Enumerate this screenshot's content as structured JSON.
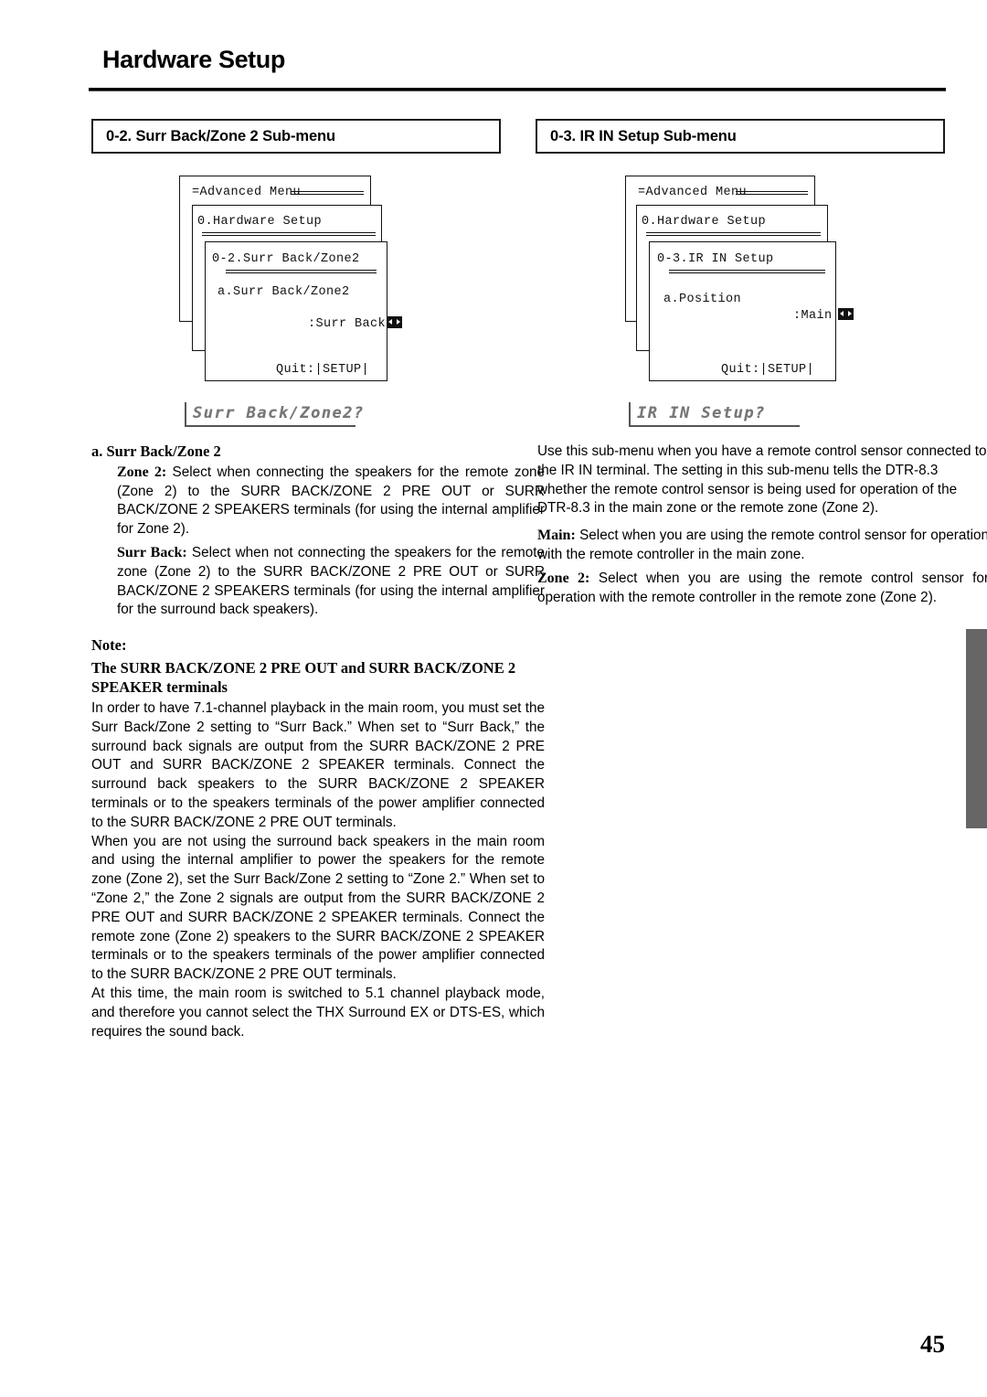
{
  "page": {
    "title": "Hardware Setup",
    "folio": "45"
  },
  "sections": {
    "left": {
      "heading": "0-2. Surr Back/Zone 2 Sub-menu"
    },
    "right": {
      "heading": "0-3. IR IN Setup Sub-menu"
    }
  },
  "osd_left": {
    "pane1_line": "=Advanced Menu",
    "pane2_line": "0.Hardware Setup",
    "pane3_title": "0-2.Surr Back/Zone2",
    "pane3_item": "a.Surr Back/Zone2",
    "pane3_value": ":Surr Back",
    "pane3_quit": "Quit:|SETUP|",
    "lcd": "Surr Back/Zone2?"
  },
  "osd_right": {
    "pane1_line": "=Advanced Menu",
    "pane2_line": "0.Hardware Setup",
    "pane3_title": "0-3.IR IN Setup",
    "pane3_item": "a.Position",
    "pane3_value": ":Main",
    "pane3_quit": "Quit:|SETUP|",
    "lcd": "IR IN Setup?"
  },
  "left_column": {
    "subhead": "a. Surr Back/Zone 2",
    "zone2_label": "Zone 2:",
    "zone2_text": " Select when connecting the speakers for the remote zone (Zone 2) to the SURR BACK/ZONE 2 PRE OUT or SURR BACK/ZONE 2 SPEAKERS terminals (for using the internal amplifier for Zone 2).",
    "surrback_label": "Surr Back:",
    "surrback_text": " Select when not connecting the speakers for the remote zone (Zone 2) to the SURR BACK/ZONE 2 PRE OUT or SURR BACK/ZONE 2 SPEAKERS terminals (for using the internal amplifier for the surround back speakers).",
    "note_heading": "Note:",
    "note_subheading": "The SURR BACK/ZONE 2 PRE OUT and SURR BACK/ZONE 2 SPEAKER terminals",
    "note_p1": "In order to have 7.1-channel playback in the main room, you must set the Surr Back/Zone 2 setting to “Surr Back.” When set to “Surr Back,” the surround back signals are output from the SURR BACK/ZONE 2 PRE OUT and SURR BACK/ZONE 2 SPEAKER terminals. Connect the surround back speakers to the SURR BACK/ZONE 2 SPEAKER terminals or to the speakers terminals of the power amplifier connected to the SURR BACK/ZONE 2 PRE OUT terminals.",
    "note_p2": "When you are not using the surround back speakers in the main room and using the internal amplifier to power the speakers for the remote zone (Zone 2), set the Surr Back/Zone 2 setting to “Zone 2.” When set to “Zone 2,” the Zone 2 signals are output from the SURR BACK/ZONE 2 PRE OUT and SURR BACK/ZONE 2 SPEAKER terminals. Connect the remote zone (Zone 2) speakers to the SURR BACK/ZONE 2 SPEAKER terminals or to the speakers terminals of the power amplifier connected to the SURR BACK/ZONE 2 PRE OUT terminals.",
    "note_p3": "At this time, the main room is switched to 5.1 channel playback mode, and therefore you cannot select the THX Surround EX or DTS-ES, which requires the sound back."
  },
  "right_column": {
    "intro": "Use this sub-menu when you have a remote control sensor connected to the IR IN terminal. The setting in this sub-menu tells the DTR-8.3 whether the remote control sensor is being used for operation of the DTR-8.3 in the main zone or the remote zone (Zone 2).",
    "main_label": "Main:",
    "main_text": " Select when you are using the remote control sensor for operation with the remote controller in the main zone.",
    "zone2_label": "Zone 2:",
    "zone2_text": " Select when you are using the remote control sensor for operation with the remote controller in the remote zone (Zone 2)."
  },
  "colors": {
    "ink": "#000000",
    "paper": "#ffffff",
    "lcd_text": "#777777",
    "edge_tab": "#666666"
  }
}
